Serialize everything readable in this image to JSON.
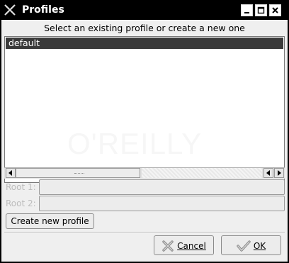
{
  "window": {
    "title": "Profiles",
    "icons": [
      "x-app-icon",
      "minimize-icon",
      "maximize-icon",
      "close-icon"
    ]
  },
  "dialog": {
    "header": "Select an existing profile or create a new one",
    "profiles": [
      "default"
    ],
    "selected_profile": "default",
    "watermark": "O'REILLY",
    "root1": {
      "label": "Root 1:",
      "value": ""
    },
    "root2": {
      "label": "Root 2:",
      "value": ""
    },
    "create_label": "Create new profile",
    "cancel_label": "Cancel",
    "ok_label": "OK"
  },
  "colors": {
    "titlebar": "#000000",
    "selection": "#3a3a3a",
    "dialog_bg": "#efefef"
  }
}
